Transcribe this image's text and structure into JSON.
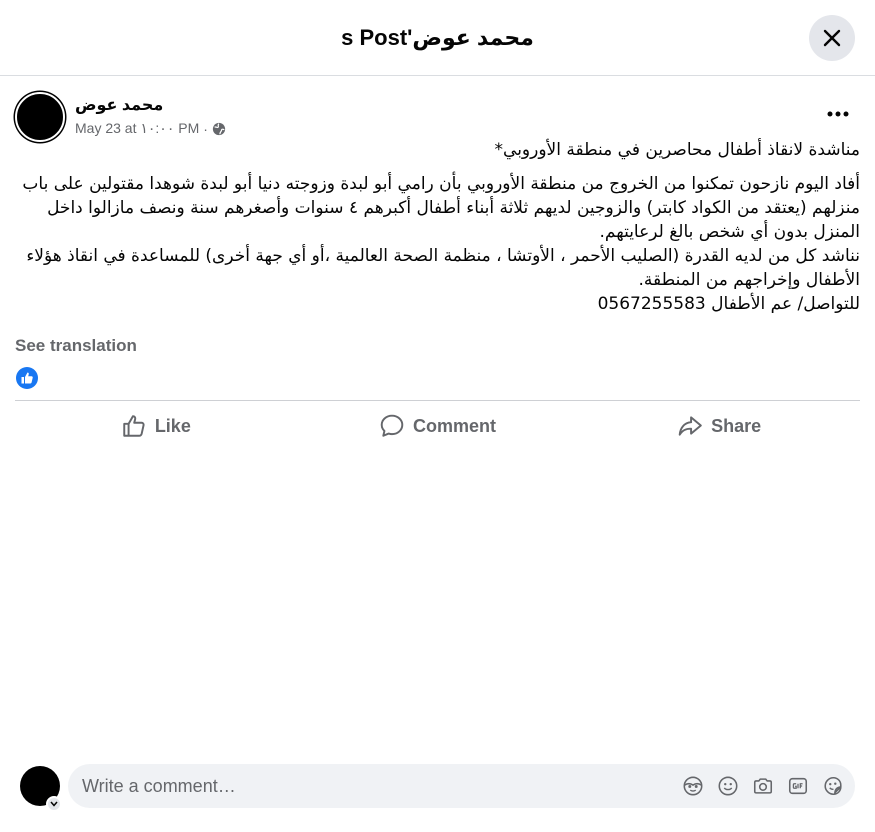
{
  "header": {
    "title": "محمد عوض's Post"
  },
  "post": {
    "author": "محمد عوض",
    "time": "May 23 at ١٠:٠٠ PM",
    "separator": "·",
    "title_line": "مناشدة  لانقاذ أطفال محاصرين في منطقة الأوروبي*",
    "paragraph_1": "أفاد اليوم نازحون تمكنوا من الخروج من منطقة الأوروبي بأن رامي أبو لبدة وزوجته دنيا أبو لبدة شوهدا مقتولين على باب منزلهم (يعتقد من الكواد كابتر) والزوجين لديهم ثلاثة أبناء أطفال أكبرهم ٤ سنوات وأصغرهم سنة ونصف مازالوا داخل المنزل بدون أي شخص بالغ لرعايتهم.",
    "paragraph_2": "نناشد كل من لديه القدرة (الصليب الأحمر ، الأوتشا ، منظمة الصحة العالمية ،أو أي جهة أخرى) للمساعدة في انقاذ هؤلاء الأطفال وإخراجهم من المنطقة.",
    "contact_line": "للتواصل/ عم الأطفال 0567255583",
    "see_translation": "See translation"
  },
  "actions": {
    "like": "Like",
    "comment": "Comment",
    "share": "Share"
  },
  "comment_box": {
    "placeholder": "Write a comment…"
  },
  "colors": {
    "accent": "#1877f2",
    "secondary_text": "#65676b",
    "input_bg": "#f0f2f5"
  }
}
